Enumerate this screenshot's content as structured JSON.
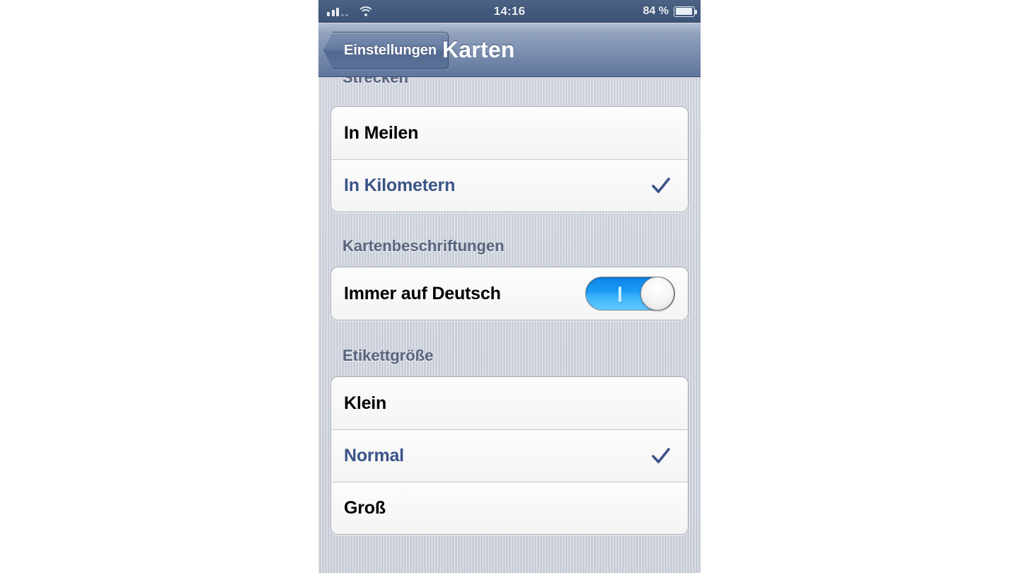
{
  "status_bar": {
    "carrier_signal_icon": "signal-bars-icon",
    "signal_bars_filled": 3,
    "signal_bars_dim": 2,
    "wifi_icon": "wifi-icon",
    "time": "14:16",
    "battery_percent": "84 %",
    "battery_level": 84,
    "battery_icon": "battery-icon"
  },
  "nav_bar": {
    "back_label": "Einstellungen",
    "back_icon": "chevron-left-icon",
    "title": "Karten"
  },
  "sections": [
    {
      "header": "Strecken",
      "rows": [
        {
          "label": "In Meilen",
          "selected": false,
          "type": "option"
        },
        {
          "label": "In Kilometern",
          "selected": true,
          "type": "option",
          "accessory_icon": "checkmark-icon"
        }
      ]
    },
    {
      "header": "Kartenbeschriftungen",
      "rows": [
        {
          "label": "Immer auf Deutsch",
          "type": "switch",
          "switch_on": true,
          "switch_icon": "toggle-switch-icon"
        }
      ]
    },
    {
      "header": "Etikettgröße",
      "rows": [
        {
          "label": "Klein",
          "selected": false,
          "type": "option"
        },
        {
          "label": "Normal",
          "selected": true,
          "type": "option",
          "accessory_icon": "checkmark-icon"
        },
        {
          "label": "Groß",
          "selected": false,
          "type": "option"
        }
      ]
    }
  ],
  "colors": {
    "selected_text": "#3b5488",
    "checkmark": "#3b5488",
    "section_header_text": "#58647d",
    "switch_on": "#1b9af4",
    "nav_bar_top": "#b3bfd3",
    "nav_bar_bottom": "#5f759d",
    "status_bar": "#42597d",
    "page_background": "#c9ced9",
    "cell_background": "#f7f7f7"
  }
}
